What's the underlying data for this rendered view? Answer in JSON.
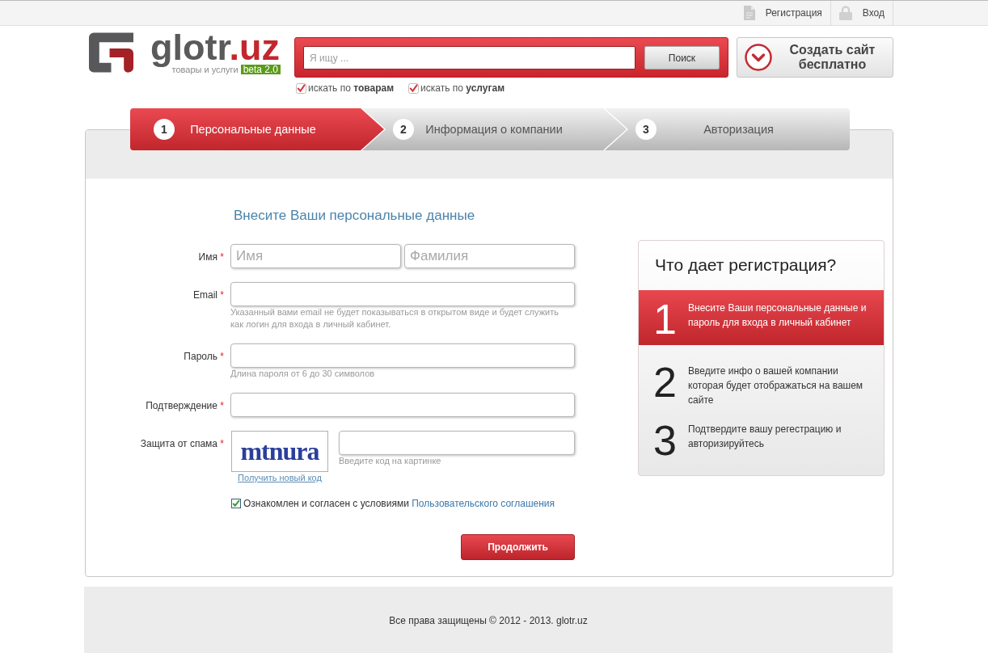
{
  "top_bar": {
    "links": [
      {
        "kind": "register",
        "label": "Регистрация"
      },
      {
        "kind": "login",
        "label": "Вход"
      }
    ]
  },
  "logo": {
    "name": "glotr",
    "domain": ".uz",
    "tagline": "товары и услуги",
    "badge": "beta 2.0"
  },
  "search": {
    "placeholder": "Я ищу ...",
    "button": "Поиск",
    "filters": [
      {
        "label": "искать по **товарам**",
        "checked": true
      },
      {
        "label": "искать по **услугам**",
        "checked": true
      }
    ]
  },
  "create_site_button": {
    "label": "Создать сайт бесплатно"
  },
  "steps": [
    {
      "number": "1",
      "label": "Персональные данные",
      "selected": true
    },
    {
      "number": "2",
      "label": "Информация о компании",
      "selected": false
    },
    {
      "number": "3",
      "label": "Авторизация",
      "selected": false
    }
  ],
  "form": {
    "title": "Внесите Ваши персональные данные",
    "required_mark": "*",
    "fields": [
      {
        "kind": "pair",
        "label": "Имя",
        "required": true,
        "inputs": [
          {
            "placeholder": "Имя"
          },
          {
            "placeholder": "Фамилия"
          }
        ]
      },
      {
        "kind": "text",
        "label": "Email",
        "required": true,
        "hint": "Указанный вами email не будет показываться в открытом виде и будет служить как логин для входа в личный кабинет."
      },
      {
        "kind": "password",
        "label": "Пароль",
        "required": true,
        "hint": "Длина пароля от 6 до 30 символов"
      },
      {
        "kind": "password",
        "label": "Подтверждение",
        "required": true
      },
      {
        "kind": "captcha",
        "label": "Защита от спама",
        "required": true,
        "code": "mtnura",
        "refresh_link": "Получить новый код",
        "hint": "Введите код на картинке"
      }
    ],
    "agreement": {
      "checked": true,
      "text": "Ознакомлен и согласен с условиями",
      "link": "Пользовательского соглашения"
    },
    "submit": "Продолжить"
  },
  "benefits": {
    "title": "Что дает регистрация?",
    "items": [
      {
        "number": "1",
        "text": "Внесите Ваши персональные данные и пароль для входа в личный кабинет",
        "active": true
      },
      {
        "number": "2",
        "text": "Введите инфо о вашей компании которая будет отображаться на вашем сайте",
        "active": false
      },
      {
        "number": "3",
        "text": "Подтвердите вашу регестрацию и авторизируйтесь",
        "active": false
      }
    ]
  },
  "footer": {
    "text": "Все права защищены © 2012 - 2013. glotr.uz"
  }
}
